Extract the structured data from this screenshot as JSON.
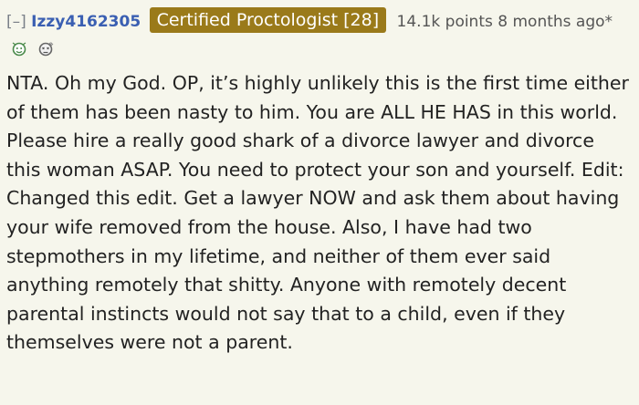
{
  "comment": {
    "collapse_label": "[–]",
    "author": "Izzy4162305",
    "flair": "Certified Proctologist [28]",
    "points": "14.1k points",
    "time": "8 months ago*",
    "awards": [
      "award-icon",
      "award-icon"
    ],
    "body": "NTA. Oh my God. OP, it’s highly unlikely this is the first time either of them has been nasty to him. You are ALL HE HAS in this world. Please hire a really good shark of a divorce lawyer and divorce this woman ASAP. You need to protect your son and yourself. Edit: Changed this edit. Get a lawyer NOW and ask them about having your wife removed from the house. Also, I have had two stepmothers in my lifetime, and neither of them ever said anything remotely that shitty. Anyone with remotely decent parental instincts would not say that to a child, even if they themselves were not a parent."
  },
  "colors": {
    "background": "#f6f6ec",
    "author": "#3a5fb2",
    "flair_background": "#9a7a1a",
    "text": "#222222"
  }
}
